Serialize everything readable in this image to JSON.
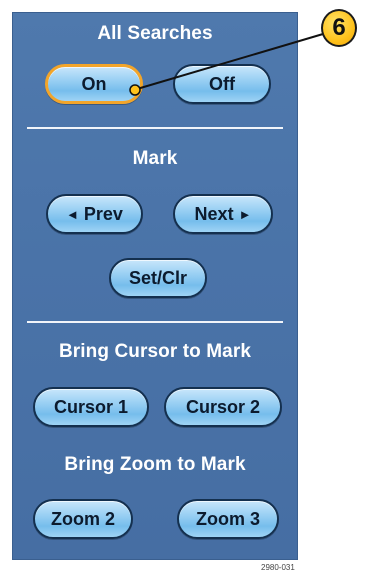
{
  "panel": {
    "sections": [
      {
        "title": "All Searches",
        "buttons": [
          {
            "label": "On",
            "active": true
          },
          {
            "label": "Off",
            "active": false
          }
        ]
      },
      {
        "title": "Mark",
        "buttons": [
          {
            "label": "Prev",
            "icon": "◄"
          },
          {
            "label": "Next",
            "icon": "►"
          },
          {
            "label": "Set/Clr"
          }
        ]
      },
      {
        "title": "Bring Cursor to Mark",
        "buttons": [
          {
            "label": "Cursor 1"
          },
          {
            "label": "Cursor 2"
          }
        ]
      },
      {
        "title": "Bring Zoom to Mark",
        "buttons": [
          {
            "label": "Zoom 2"
          },
          {
            "label": "Zoom 3"
          }
        ]
      }
    ]
  },
  "callout": {
    "number": "6"
  },
  "figure_id": "2980-031",
  "colors": {
    "panel_background": "#4a73a8",
    "button_fill": "#8ccaf1",
    "button_border": "#14304f",
    "active_border": "#f2a52a",
    "callout_fill": "#ffc21c"
  }
}
